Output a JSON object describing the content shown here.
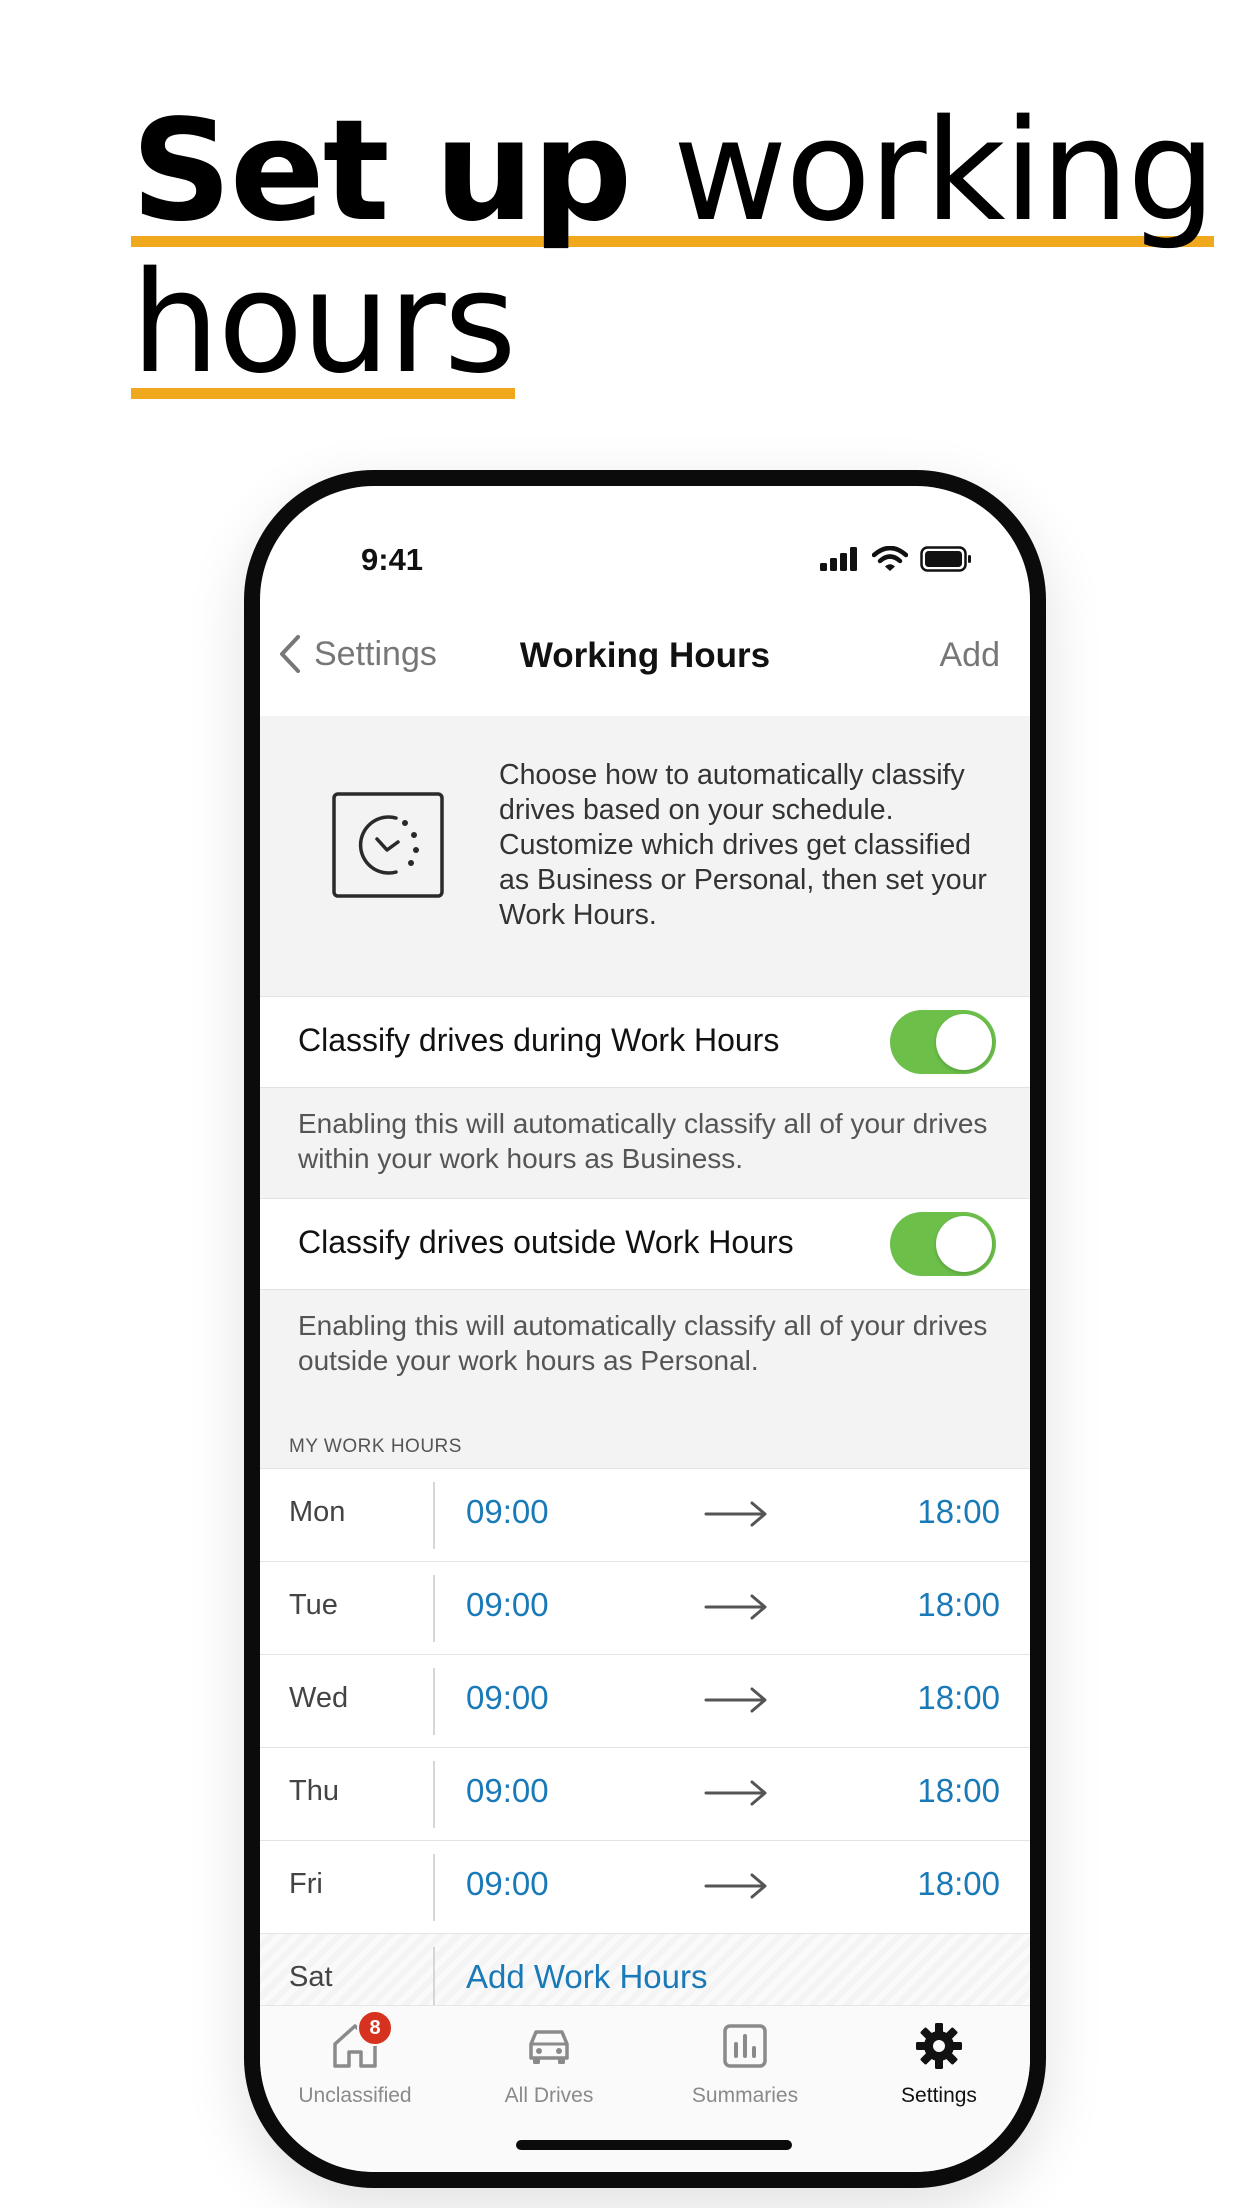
{
  "headline": {
    "part1": "Set up",
    "part2": "working",
    "part3": "hours"
  },
  "status_bar": {
    "time": "9:41",
    "icons": [
      "cellular-signal-icon",
      "wifi-icon",
      "battery-icon"
    ]
  },
  "nav": {
    "back_label": "Settings",
    "title": "Working Hours",
    "action_label": "Add"
  },
  "intro": {
    "icon": "clock-schedule-icon",
    "text": "Choose how to automatically classify drives based on your schedule. Customize which drives get classified as Business or Personal, then set your Work Hours."
  },
  "settings": [
    {
      "label": "Classify drives during Work Hours",
      "enabled": true,
      "note": "Enabling this will automatically classify all of your drives within your work hours as Business."
    },
    {
      "label": "Classify drives outside Work Hours",
      "enabled": true,
      "note": "Enabling this will automatically classify all of your drives outside your work hours as Personal."
    }
  ],
  "work_hours": {
    "header": "MY WORK HOURS",
    "days": [
      {
        "day": "Mon",
        "start": "09:00",
        "end": "18:00"
      },
      {
        "day": "Tue",
        "start": "09:00",
        "end": "18:00"
      },
      {
        "day": "Wed",
        "start": "09:00",
        "end": "18:00"
      },
      {
        "day": "Thu",
        "start": "09:00",
        "end": "18:00"
      },
      {
        "day": "Fri",
        "start": "09:00",
        "end": "18:00"
      },
      {
        "day": "Sat",
        "action": "Add Work Hours"
      }
    ]
  },
  "tabs": [
    {
      "label": "Unclassified",
      "icon": "home-icon",
      "badge": "8",
      "active": false
    },
    {
      "label": "All Drives",
      "icon": "car-icon",
      "active": false
    },
    {
      "label": "Summaries",
      "icon": "bar-chart-icon",
      "active": false
    },
    {
      "label": "Settings",
      "icon": "gear-icon",
      "active": true
    }
  ],
  "colors": {
    "accent_underline": "#f0a81c",
    "toggle_on": "#6cc04a",
    "link_blue": "#1a7ab8",
    "badge_red": "#d6321f"
  }
}
